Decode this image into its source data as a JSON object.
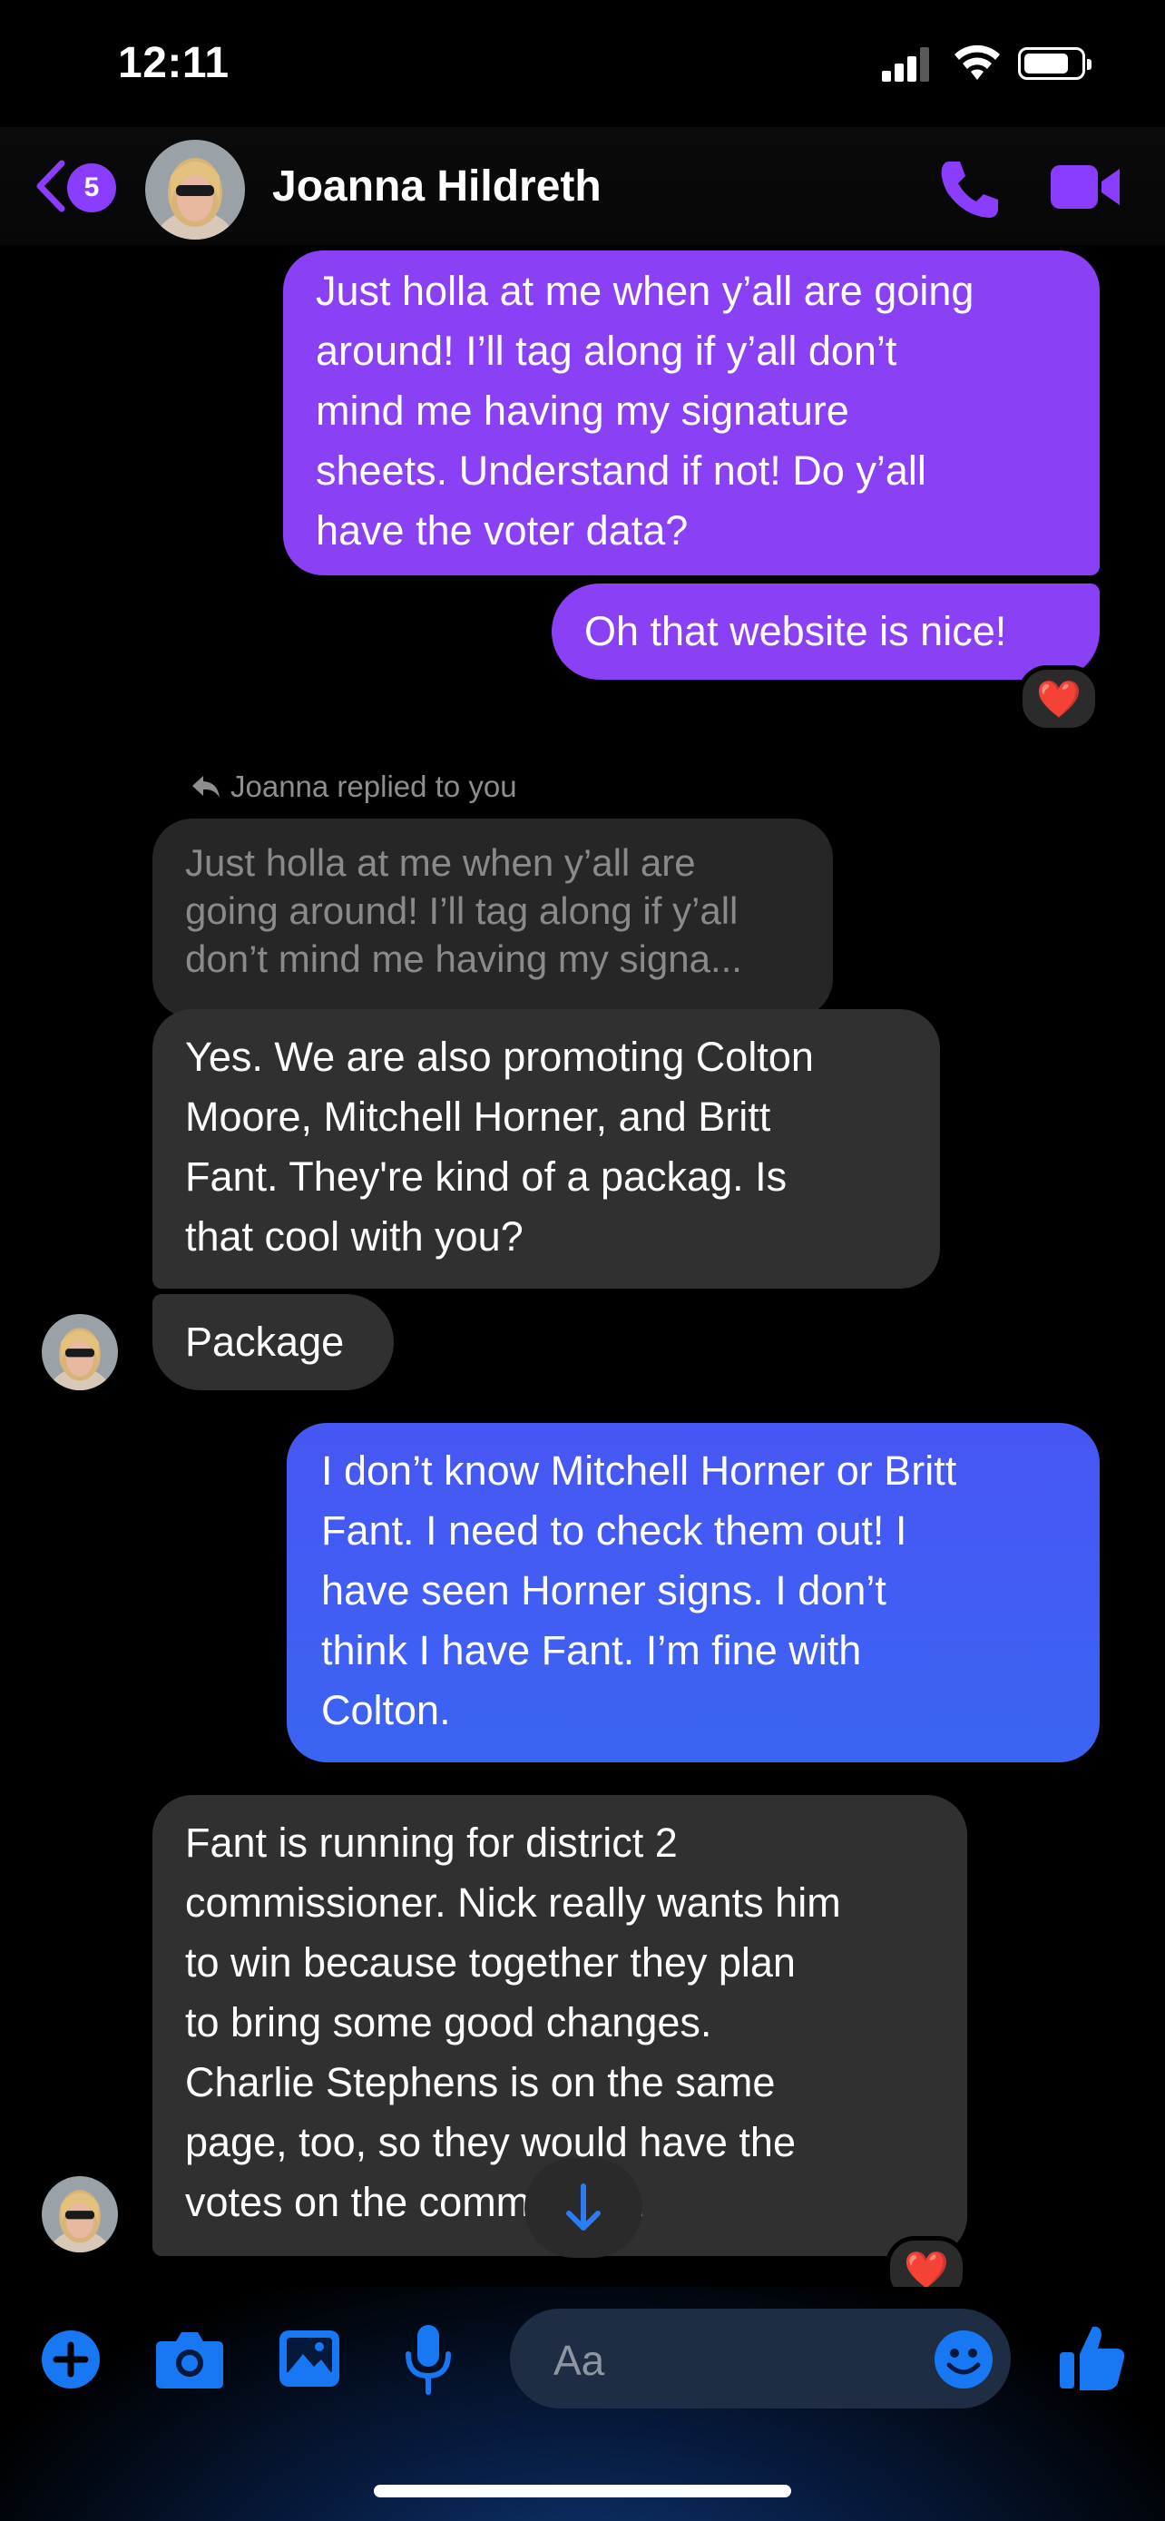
{
  "status_bar": {
    "time": "12:11"
  },
  "header": {
    "back_count": "5",
    "contact_name": "Joanna Hildreth"
  },
  "messages": [
    {
      "dir": "out",
      "lines": [
        "Just holla at me when y’all are going",
        "around! I’ll tag along if y’all don’t",
        "mind me having my signature",
        "sheets. Understand if not! Do y’all",
        "have the voter data?"
      ]
    },
    {
      "dir": "out",
      "lines": [
        "Oh that website is nice!"
      ],
      "reaction": "❤️"
    },
    {
      "dir": "in",
      "reply_label": "Joanna replied to you",
      "quoted_lines": [
        "Just holla at me when y’all are",
        "going around! I’ll tag along if y’all",
        "don’t mind me having my signa..."
      ],
      "lines": [
        "Yes. We are also promoting Colton",
        "Moore, Mitchell Horner, and Britt",
        "Fant. They're kind of a packag. Is",
        "that cool with you?"
      ]
    },
    {
      "dir": "in",
      "lines": [
        "Package"
      ]
    },
    {
      "dir": "out",
      "lines": [
        "I don’t know Mitchell Horner or Britt",
        "Fant. I need to check them out! I",
        "have seen Horner signs. I don’t",
        "think I have Fant. I’m fine with",
        "Colton."
      ]
    },
    {
      "dir": "in",
      "lines": [
        "Fant is running for district 2",
        "commissioner. Nick really wants him",
        "to win because together they plan",
        "to bring some good changes.",
        "Charlie Stephens is on the same",
        "page, too, so they would have the",
        "votes on the commission."
      ],
      "reaction": "❤️"
    }
  ],
  "composer": {
    "placeholder": "Aa"
  },
  "colors": {
    "accent": "#8b3dff",
    "blue": "#1877f2",
    "incoming": "#303030"
  }
}
